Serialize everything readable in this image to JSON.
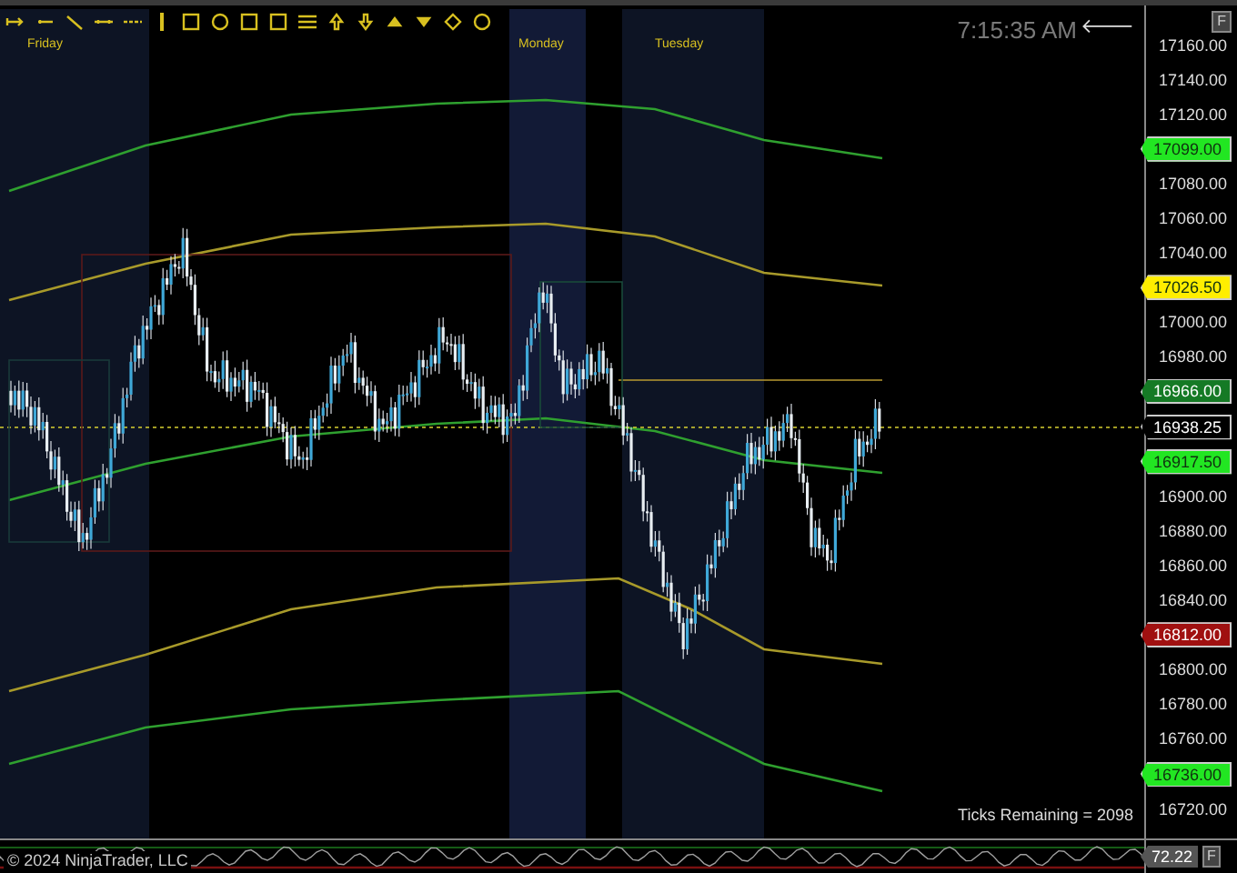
{
  "chart": {
    "time": "7:15:35 AM",
    "back_arrow": "🡐",
    "day_labels": [
      {
        "label": "Friday"
      },
      {
        "label": "Monday"
      },
      {
        "label": "Tuesday"
      }
    ],
    "ticks_remaining": "Ticks Remaining = 2098",
    "copyright": "© 2024 NinjaTrader, LLC"
  },
  "price_axis": {
    "corner": "F",
    "slots": [
      {
        "kind": "tick",
        "label": "17160.00"
      },
      {
        "kind": "tick",
        "label": "17140.00"
      },
      {
        "kind": "tick",
        "label": "17120.00"
      },
      {
        "kind": "badge",
        "label": "17099.00",
        "color": "#22e622"
      },
      {
        "kind": "tick",
        "label": "17080.00"
      },
      {
        "kind": "tick",
        "label": "17060.00"
      },
      {
        "kind": "tick",
        "label": "17040.00"
      },
      {
        "kind": "badge",
        "label": "17026.50",
        "color": "#ffee00"
      },
      {
        "kind": "tick",
        "label": "17000.00"
      },
      {
        "kind": "tick",
        "label": "16980.00"
      },
      {
        "kind": "badge",
        "label": "16966.00",
        "color": "#157a25"
      },
      {
        "kind": "badge",
        "label": "16938.25",
        "color": "#000000"
      },
      {
        "kind": "badge",
        "label": "16917.50",
        "color": "#22e622"
      },
      {
        "kind": "tick",
        "label": "16900.00"
      },
      {
        "kind": "tick",
        "label": "16880.00"
      },
      {
        "kind": "tick",
        "label": "16860.00"
      },
      {
        "kind": "tick",
        "label": "16840.00"
      },
      {
        "kind": "badge",
        "label": "16812.00",
        "color": "#a01010"
      },
      {
        "kind": "tick",
        "label": "16800.00"
      },
      {
        "kind": "tick",
        "label": "16780.00"
      },
      {
        "kind": "tick",
        "label": "16760.00"
      },
      {
        "kind": "badge",
        "label": "16736.00",
        "color": "#22e622"
      },
      {
        "kind": "tick",
        "label": "16720.00"
      }
    ]
  },
  "indicator": {
    "badge": "72.22",
    "corner": "F"
  }
}
